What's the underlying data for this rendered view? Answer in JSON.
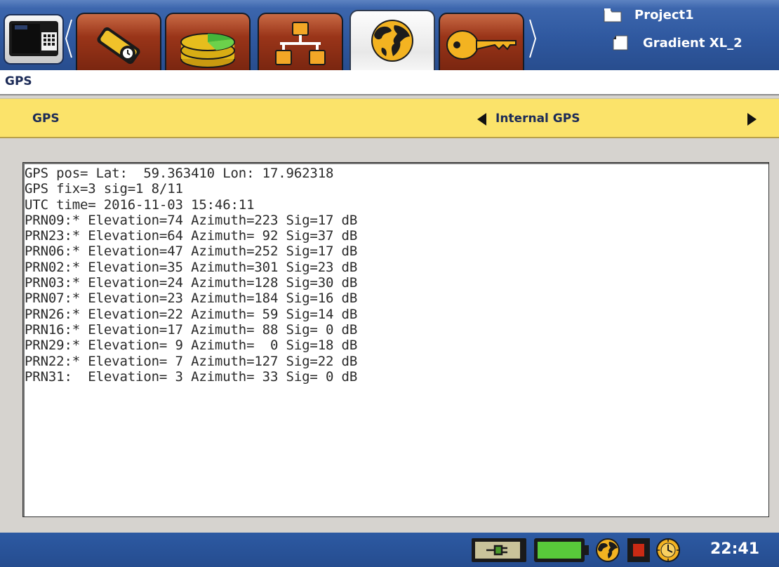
{
  "header": {
    "project": "Project1",
    "configuration": "Gradient XL_2",
    "tabs": [
      {
        "icon": "survey-tool-icon",
        "active": false
      },
      {
        "icon": "database-icon",
        "active": false
      },
      {
        "icon": "network-icon",
        "active": false
      },
      {
        "icon": "globe-icon",
        "active": true
      },
      {
        "icon": "key-icon",
        "active": false
      }
    ]
  },
  "page": {
    "title": "GPS"
  },
  "selector": {
    "label": "GPS",
    "value": "Internal GPS"
  },
  "gps_output": {
    "lines": [
      "GPS pos= Lat:  59.363410 Lon: 17.962318",
      "GPS fix=3 sig=1 8/11",
      "UTC time= 2016-11-03 15:46:11",
      "PRN09:* Elevation=74 Azimuth=223 Sig=17 dB",
      "PRN23:* Elevation=64 Azimuth= 92 Sig=37 dB",
      "PRN06:* Elevation=47 Azimuth=252 Sig=17 dB",
      "PRN02:* Elevation=35 Azimuth=301 Sig=23 dB",
      "PRN03:* Elevation=24 Azimuth=128 Sig=30 dB",
      "PRN07:* Elevation=23 Azimuth=184 Sig=16 dB",
      "PRN26:* Elevation=22 Azimuth= 59 Sig=14 dB",
      "PRN16:* Elevation=17 Azimuth= 88 Sig= 0 dB",
      "PRN29:* Elevation= 9 Azimuth=  0 Sig=18 dB",
      "PRN22:* Elevation= 7 Azimuth=127 Sig=22 dB",
      "PRN31:  Elevation= 3 Azimuth= 33 Sig= 0 dB"
    ]
  },
  "status": {
    "clock": "22:41",
    "icons": [
      "power-plug-icon",
      "battery-icon",
      "gps-globe-icon",
      "record-indicator-icon",
      "clock-icon"
    ],
    "colors": {
      "bar": "#2b569f",
      "battery_fill": "#58c93a",
      "record": "#c92a14"
    }
  },
  "colors": {
    "title_text": "#1c2b57",
    "selector_bg": "#fbe36a",
    "tab_inactive": "#9a3519",
    "toolbar": "#2f589f"
  }
}
